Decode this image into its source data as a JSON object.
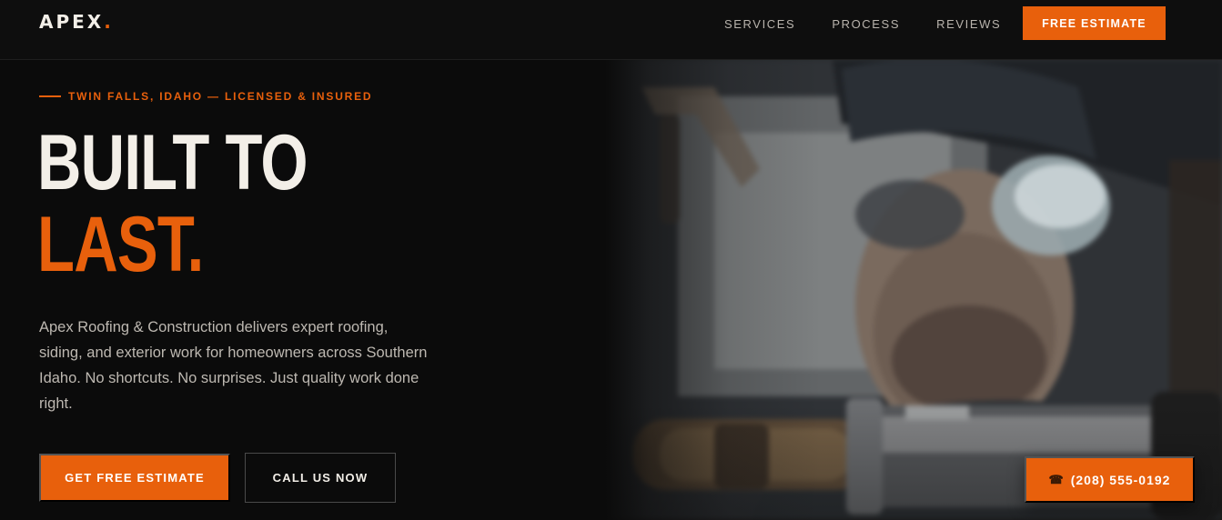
{
  "brand": {
    "name": "APEX",
    "dot": "."
  },
  "nav": {
    "items": [
      {
        "label": "SERVICES"
      },
      {
        "label": "PROCESS"
      },
      {
        "label": "REVIEWS"
      }
    ],
    "cta_label": "FREE ESTIMATE"
  },
  "hero": {
    "eyebrow": "TWIN FALLS, IDAHO — LICENSED & INSURED",
    "headline_line1": "BUILT TO",
    "headline_line2": "LAST.",
    "lede": "Apex Roofing & Construction delivers expert roofing, siding, and exterior work for homeowners across Southern Idaho. No shortcuts. No surprises. Just quality work done right.",
    "primary_cta": "GET FREE ESTIMATE",
    "secondary_cta": "CALL US NOW"
  },
  "floating_call": {
    "icon": "phone-icon",
    "label": "(208) 555-0192"
  },
  "colors": {
    "accent": "#e8600c",
    "background": "#0b0b0b",
    "text": "#f3efe8",
    "muted": "#bdb8b1"
  }
}
